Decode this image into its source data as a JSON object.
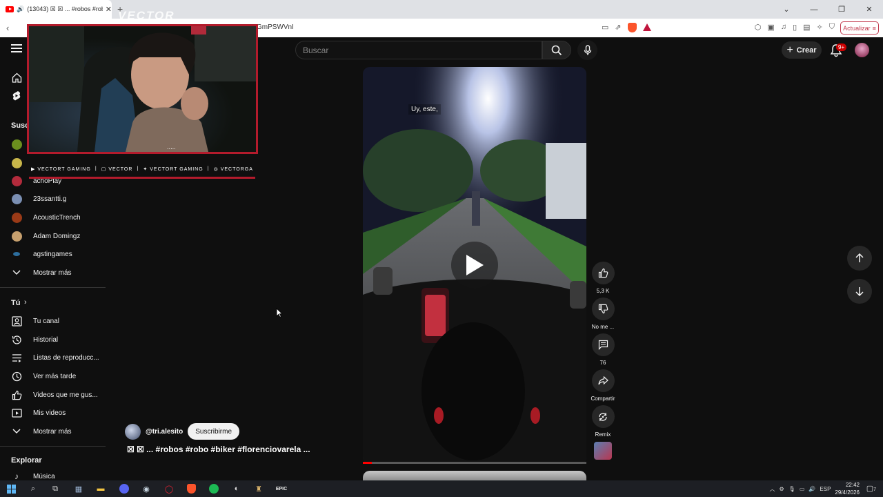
{
  "browser": {
    "tab_title": "(13043) ☒ ☒ ... #robos #rob",
    "tab_close": "✕",
    "new_tab": "+",
    "url_fragment": "GmPSWVnI",
    "update_label": "Actualizar",
    "window_controls": [
      "⌄",
      "—",
      "❐",
      "✕"
    ]
  },
  "header": {
    "search_placeholder": "Buscar",
    "create_label": "Crear",
    "notif_count": "9+"
  },
  "sidebar": {
    "subs_heading": "Susc",
    "subscriptions": [
      {
        "label": "",
        "color": "#6b8f1e"
      },
      {
        "label": "",
        "color": "#c8b64a"
      },
      {
        "label": "achoPlay",
        "color": "#b32b3c"
      },
      {
        "label": "23ssantti.g",
        "color": "#7b8fb3"
      },
      {
        "label": "AcousticTrench",
        "color": "#9a3a17"
      },
      {
        "label": "Adam Domingz",
        "color": "#c7a06e"
      },
      {
        "label": "agstingames",
        "color": "#2d6e9e"
      }
    ],
    "show_more_1": "Mostrar más",
    "you_heading": "Tú",
    "you_items": [
      "Tu canal",
      "Historial",
      "Listas de reproducc...",
      "Ver más tarde",
      "Videos que me gus...",
      "Mis videos"
    ],
    "show_more_2": "Mostrar más",
    "explore_heading": "Explorar",
    "explore_items": [
      "Música"
    ]
  },
  "overlay": {
    "logo": "VECTOR",
    "socials": [
      "VECTORT GAMING",
      "VECTOR",
      "VECTORT GAMING",
      "VECTORGA"
    ]
  },
  "short": {
    "caption": "Uy, este,",
    "channel": "@tri.alesito",
    "subscribe_label": "Suscribirme",
    "title": "☒ ☒ ... #robos #robo #biker #florenciovarela ...",
    "progress": 0.04,
    "actions": {
      "likes": "5,3 K",
      "dislike": "No me ...",
      "comments": "76",
      "share": "Compartir",
      "remix": "Remix"
    }
  },
  "taskbar": {
    "lang": "ESP",
    "time": "22:42",
    "date": "29/4/2026",
    "notif": "7"
  }
}
